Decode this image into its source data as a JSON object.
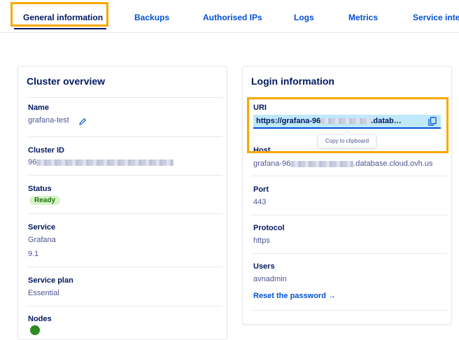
{
  "tabs": [
    {
      "label": "General information"
    },
    {
      "label": "Backups"
    },
    {
      "label": "Authorised IPs"
    },
    {
      "label": "Logs"
    },
    {
      "label": "Metrics"
    },
    {
      "label": "Service integ"
    }
  ],
  "cluster": {
    "title": "Cluster overview",
    "name_label": "Name",
    "name_value": "grafana-test",
    "id_label": "Cluster ID",
    "id_prefix": "96",
    "status_label": "Status",
    "status_value": "Ready",
    "service_label": "Service",
    "service_value": "Grafana",
    "service_version": "9.1",
    "plan_label": "Service plan",
    "plan_value": "Essential",
    "nodes_label": "Nodes"
  },
  "login": {
    "title": "Login information",
    "uri_label": "URI",
    "uri_prefix": "https://grafana-96",
    "uri_suffix": ".datab…",
    "tooltip": "Copy to clipboard",
    "host_label": "Host",
    "host_prefix": "grafana-96",
    "host_suffix": ".database.cloud.ovh.us",
    "port_label": "Port",
    "port_value": "443",
    "protocol_label": "Protocol",
    "protocol_value": "https",
    "users_label": "Users",
    "users_value": "avnadmin",
    "reset_link": "Reset the password →"
  },
  "colors": {
    "accent": "#0050d7",
    "highlight": "#f6a800",
    "heading": "#00185e",
    "ready_bg": "#d5f5c8"
  }
}
